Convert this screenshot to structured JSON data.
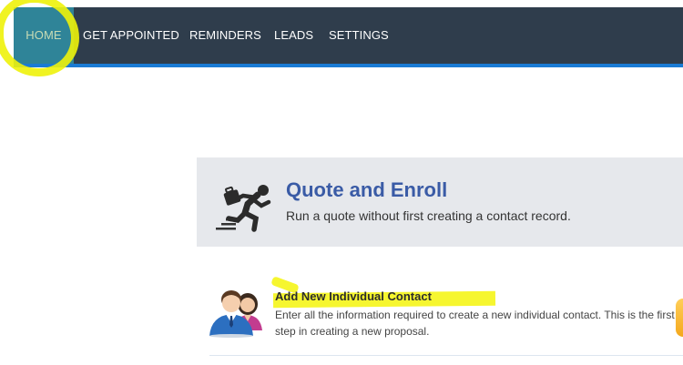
{
  "nav": {
    "items": [
      {
        "label": "HOME",
        "active": true
      },
      {
        "label": "GET APPOINTED"
      },
      {
        "label": "REMINDERS"
      },
      {
        "label": "LEADS"
      },
      {
        "label": "SETTINGS"
      }
    ],
    "bar_color": "#2f3d4c",
    "active_color": "#1a7bd4"
  },
  "quote": {
    "title": "Quote and Enroll",
    "description": "Run a quote without first creating a contact record.",
    "icon": "running-person-icon"
  },
  "contact": {
    "title": "Add New Individual Contact",
    "description": "Enter all the information required to create a new individual contact. This is the first step in creating a new proposal.",
    "icon": "contacts-people-icon"
  },
  "annotation_color": "#f2f20a"
}
